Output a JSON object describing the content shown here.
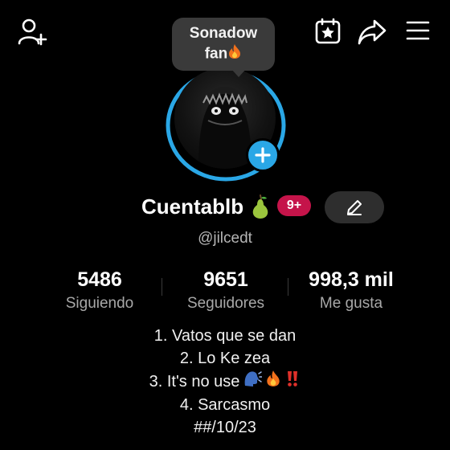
{
  "header": {
    "add_friend_icon": "person-add-icon",
    "calendar_icon": "calendar-star-icon",
    "share_icon": "share-icon",
    "menu_icon": "hamburger-menu-icon"
  },
  "bubble": {
    "line1": "Sonadow",
    "line2": "fan"
  },
  "profile": {
    "display_name": "Cuentablb",
    "badge_count": "9+",
    "handle": "@jilcedt"
  },
  "stats": [
    {
      "value": "5486",
      "label": "Siguiendo"
    },
    {
      "value": "9651",
      "label": "Seguidores"
    },
    {
      "value": "998,3 mil",
      "label": "Me gusta"
    }
  ],
  "bio": {
    "line1": "1. Vatos que se dan",
    "line2": "2. Lo Ke zea",
    "line3": "3. It's no use",
    "line4": "4. Sarcasmo",
    "line5": "##/10/23"
  },
  "colors": {
    "background": "#000000",
    "ring": "#2aa7e6",
    "badge": "#c5144a",
    "edit_button": "#2e2e2e"
  }
}
